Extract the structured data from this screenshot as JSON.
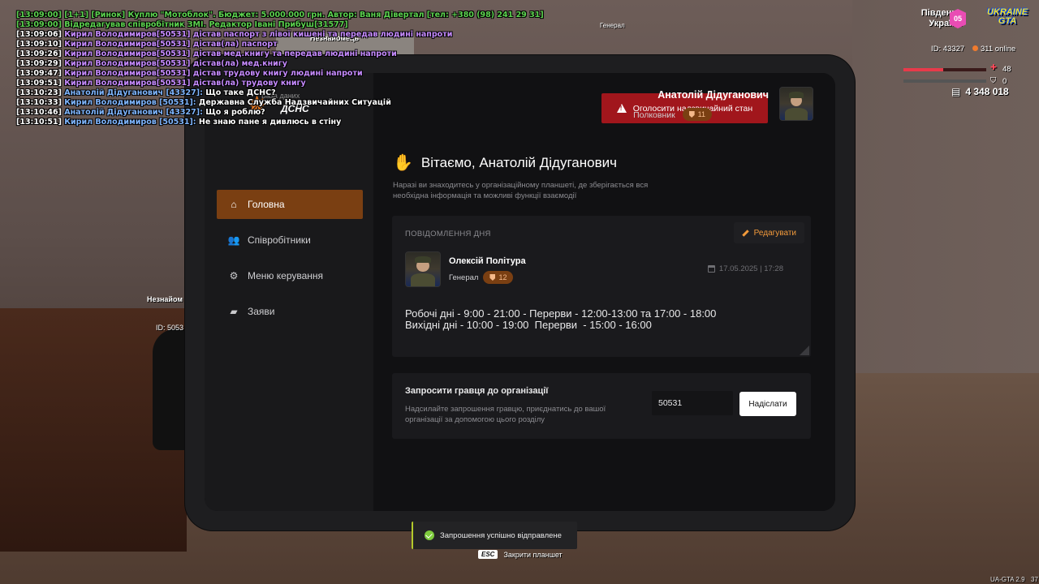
{
  "chat": [
    {
      "cls": "c-green",
      "text": "[13:09:00] [1+1] [Ринок] Куплю \"Мотоблок\". Бюджет: 5.000.000 грн. Автор: Ваня Дівертал [тел: +380 (98) 241 29 31]"
    },
    {
      "cls": "c-green",
      "text": "[13:09:00] Відредагував співробітник ЗМІ. Редактор Івані Прибуш[31577]"
    },
    {
      "cls": "c-purple",
      "ts": "[13:09:06]",
      "text": " Кирил Володимиров[50531] дістав паспорт з лівої кишені та передав людині напроти"
    },
    {
      "cls": "c-purple",
      "ts": "[13:09:10]",
      "text": " Кирил Володимиров[50531] дістав(ла) паспорт"
    },
    {
      "cls": "c-purple",
      "ts": "[13:09:26]",
      "text": " Кирил Володимиров[50531] дістав мед.книгу та передав людині напроти"
    },
    {
      "cls": "c-purple",
      "ts": "[13:09:29]",
      "text": " Кирил Володимиров[50531] дістав(ла) мед.книгу"
    },
    {
      "cls": "c-purple",
      "ts": "[13:09:47]",
      "text": " Кирил Володимиров[50531] дістав трудову книгу людині напроти"
    },
    {
      "cls": "c-purple",
      "ts": "[13:09:51]",
      "text": " Кирил Володимиров[50531] дістав(ла) трудову книгу"
    },
    {
      "cls": "c-blue",
      "ts": "[13:10:23]",
      "text": " Анатолій Дідуганович [43327]:",
      "tail": " Що таке ДСНС?"
    },
    {
      "cls": "c-blue",
      "ts": "[13:10:33]",
      "text": " Кирил Володимиров [50531]:",
      "tail": " Державна Служба Надзвичайних Ситуацій"
    },
    {
      "cls": "c-blue",
      "ts": "[13:10:46]",
      "text": " Анатолій Дідуганович [43327]:",
      "tail": " Що я роблю?"
    },
    {
      "cls": "c-blue",
      "ts": "[13:10:51]",
      "text": " Кирил Володимиров [50531]:",
      "tail": " Не знаю пане я дивлюсь в стіну"
    }
  ],
  "world": {
    "general_label": "Генерал",
    "unknown_label_top": "Незнайомець",
    "unknown_label": "Незнайом",
    "id_label": "ID: 5053"
  },
  "hud": {
    "region_line1": "Південна",
    "region_line2": "Україна",
    "region_badge": "05",
    "logo_line1": "UKRAINE",
    "logo_line2": "GTA",
    "player_id": "ID: 43327",
    "online": "311 online",
    "health": "48",
    "health_fraction": 0.48,
    "armor": "0",
    "money": "4 348 018"
  },
  "tablet": {
    "brand_small": "База даних",
    "brand_name": "ДСНС",
    "nav": [
      {
        "label": "Головна",
        "icon": "home-icon",
        "glyph": "⌂",
        "active": true
      },
      {
        "label": "Співробітники",
        "icon": "users-icon",
        "glyph": "👥",
        "active": false
      },
      {
        "label": "Меню керування",
        "icon": "gear-icon",
        "glyph": "⚙",
        "active": false
      },
      {
        "label": "Заяви",
        "icon": "folder-icon",
        "glyph": "▰",
        "active": false
      }
    ],
    "alarm_button": "Оголосити надзвичайний стан",
    "user_name": "Анатолій Дідуганович",
    "user_rank": "Полковник",
    "user_rank_level": "11",
    "welcome_title": "Вітаємо, Анатолій Дідуганович",
    "welcome_icon": "waving-hand-icon",
    "welcome_sub": "Наразі ви знаходитесь у організаційному планшеті, де зберігається вся необхідна інформація та можливі функції взаємодії",
    "message": {
      "label": "ПОВІДОМЛЕННЯ ДНЯ",
      "edit_label": "Редагувати",
      "author": "Олексій Політура",
      "author_rank": "Генерал",
      "author_rank_level": "12",
      "date": "17.05.2025 | 17:28",
      "text": "Робочі дні - 9:00 - 21:00 - Перерви - 12:00-13:00 та 17:00 - 18:00\nВихідні дні - 10:00 - 19:00  Перерви  - 15:00 - 16:00"
    },
    "invite": {
      "title": "Запросити гравця до організації",
      "desc": "Надсилайте запрошення гравцю, приєднатись до вашої організації за допомогою цього розділу",
      "value": "50531",
      "button": "Надіслати"
    }
  },
  "toast": "Запрошення успішно відправлене",
  "close_hint": {
    "key": "ESC",
    "label": "Закрити планшет"
  },
  "version": "UA-GTA 2.9",
  "corner": "37",
  "colors": {
    "accent": "#7a3f12",
    "alarm": "#a1161c",
    "edit": "#f29a3b",
    "success": "#7ecb3c"
  }
}
